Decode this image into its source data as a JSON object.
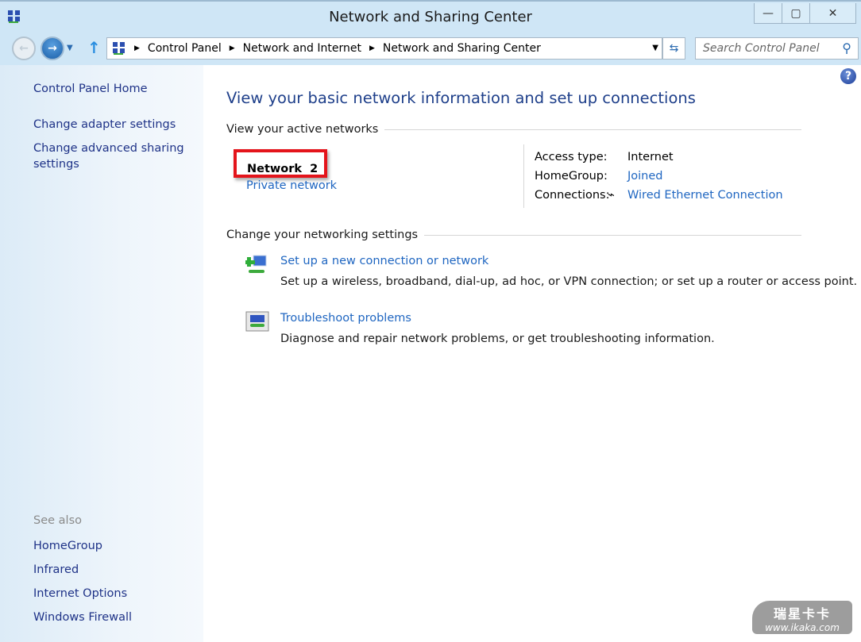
{
  "window": {
    "title": "Network and Sharing Center",
    "minimize": "—",
    "maximize": "▢",
    "close": "✕"
  },
  "nav": {
    "breadcrumb": [
      "Control Panel",
      "Network and Internet",
      "Network and Sharing Center"
    ],
    "search_placeholder": "Search Control Panel"
  },
  "sidebar": {
    "links": [
      "Control Panel Home",
      "Change adapter settings",
      "Change advanced sharing settings"
    ],
    "see_also_label": "See also",
    "see_also": [
      "HomeGroup",
      "Infrared",
      "Internet Options",
      "Windows Firewall"
    ]
  },
  "main": {
    "heading": "View your basic network information and set up connections",
    "active_networks_label": "View your active networks",
    "network": {
      "name": "Network  2",
      "type": "Private network"
    },
    "details": [
      {
        "label": "Access type:",
        "value": "Internet"
      },
      {
        "label": "HomeGroup:",
        "value": "Joined"
      },
      {
        "label": "Connections:",
        "value": "Wired Ethernet Connection"
      }
    ],
    "settings_label": "Change your networking settings",
    "tasks": [
      {
        "title": "Set up a new connection or network",
        "desc": "Set up a wireless, broadband, dial-up, ad hoc, or VPN connection; or set up a router or access point."
      },
      {
        "title": "Troubleshoot problems",
        "desc": "Diagnose and repair network problems, or get troubleshooting information."
      }
    ],
    "help": "?"
  },
  "watermark": {
    "brand": "瑞星卡卡",
    "url": "www.ikaka.com"
  },
  "colors": {
    "link": "#1f66c1",
    "heading": "#1e3f8a",
    "highlight": "#e4141b"
  }
}
